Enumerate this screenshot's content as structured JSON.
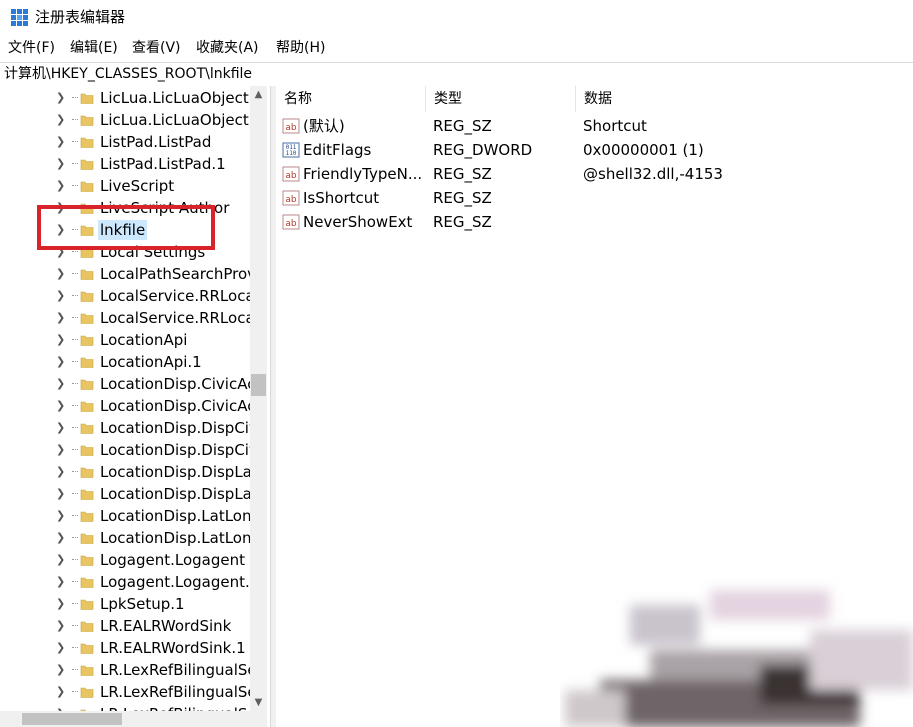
{
  "window": {
    "title": "注册表编辑器"
  },
  "menu": {
    "items": [
      "文件(F)",
      "编辑(E)",
      "查看(V)",
      "收藏夹(A)",
      "帮助(H)"
    ]
  },
  "address": {
    "path": "计算机\\HKEY_CLASSES_ROOT\\lnkfile"
  },
  "tree": {
    "items": [
      "LicLua.LicLuaObject",
      "LicLua.LicLuaObject.",
      "ListPad.ListPad",
      "ListPad.ListPad.1",
      "LiveScript",
      "LiveScript Author",
      "lnkfile",
      "Local Settings",
      "LocalPathSearchProv",
      "LocalService.RRLoca",
      "LocalService.RRLoca",
      "LocationApi",
      "LocationApi.1",
      "LocationDisp.CivicAc",
      "LocationDisp.CivicAc",
      "LocationDisp.DispCiv",
      "LocationDisp.DispCiv",
      "LocationDisp.DispLa",
      "LocationDisp.DispLa",
      "LocationDisp.LatLon",
      "LocationDisp.LatLon",
      "Logagent.Logagent",
      "Logagent.Logagent.",
      "LpkSetup.1",
      "LR.EALRWordSink",
      "LR.EALRWordSink.1",
      "LR.LexRefBilingualSe",
      "LR.LexRefBilingualSe",
      "LR.LexRefBilingualSe"
    ],
    "selected": "lnkfile"
  },
  "list": {
    "headers": {
      "name": "名称",
      "type": "类型",
      "data": "数据"
    },
    "rows": [
      {
        "icon": "string-value-icon",
        "name": "(默认)",
        "type": "REG_SZ",
        "data": "Shortcut"
      },
      {
        "icon": "binary-value-icon",
        "name": "EditFlags",
        "type": "REG_DWORD",
        "data": "0x00000001 (1)"
      },
      {
        "icon": "string-value-icon",
        "name": "FriendlyTypeN...",
        "type": "REG_SZ",
        "data": "@shell32.dll,-4153"
      },
      {
        "icon": "string-value-icon",
        "name": "IsShortcut",
        "type": "REG_SZ",
        "data": ""
      },
      {
        "icon": "string-value-icon",
        "name": "NeverShowExt",
        "type": "REG_SZ",
        "data": ""
      }
    ]
  },
  "colors": {
    "highlight_box": "#d9232a",
    "selection": "#cce8ff",
    "folder": "#e8c560"
  }
}
